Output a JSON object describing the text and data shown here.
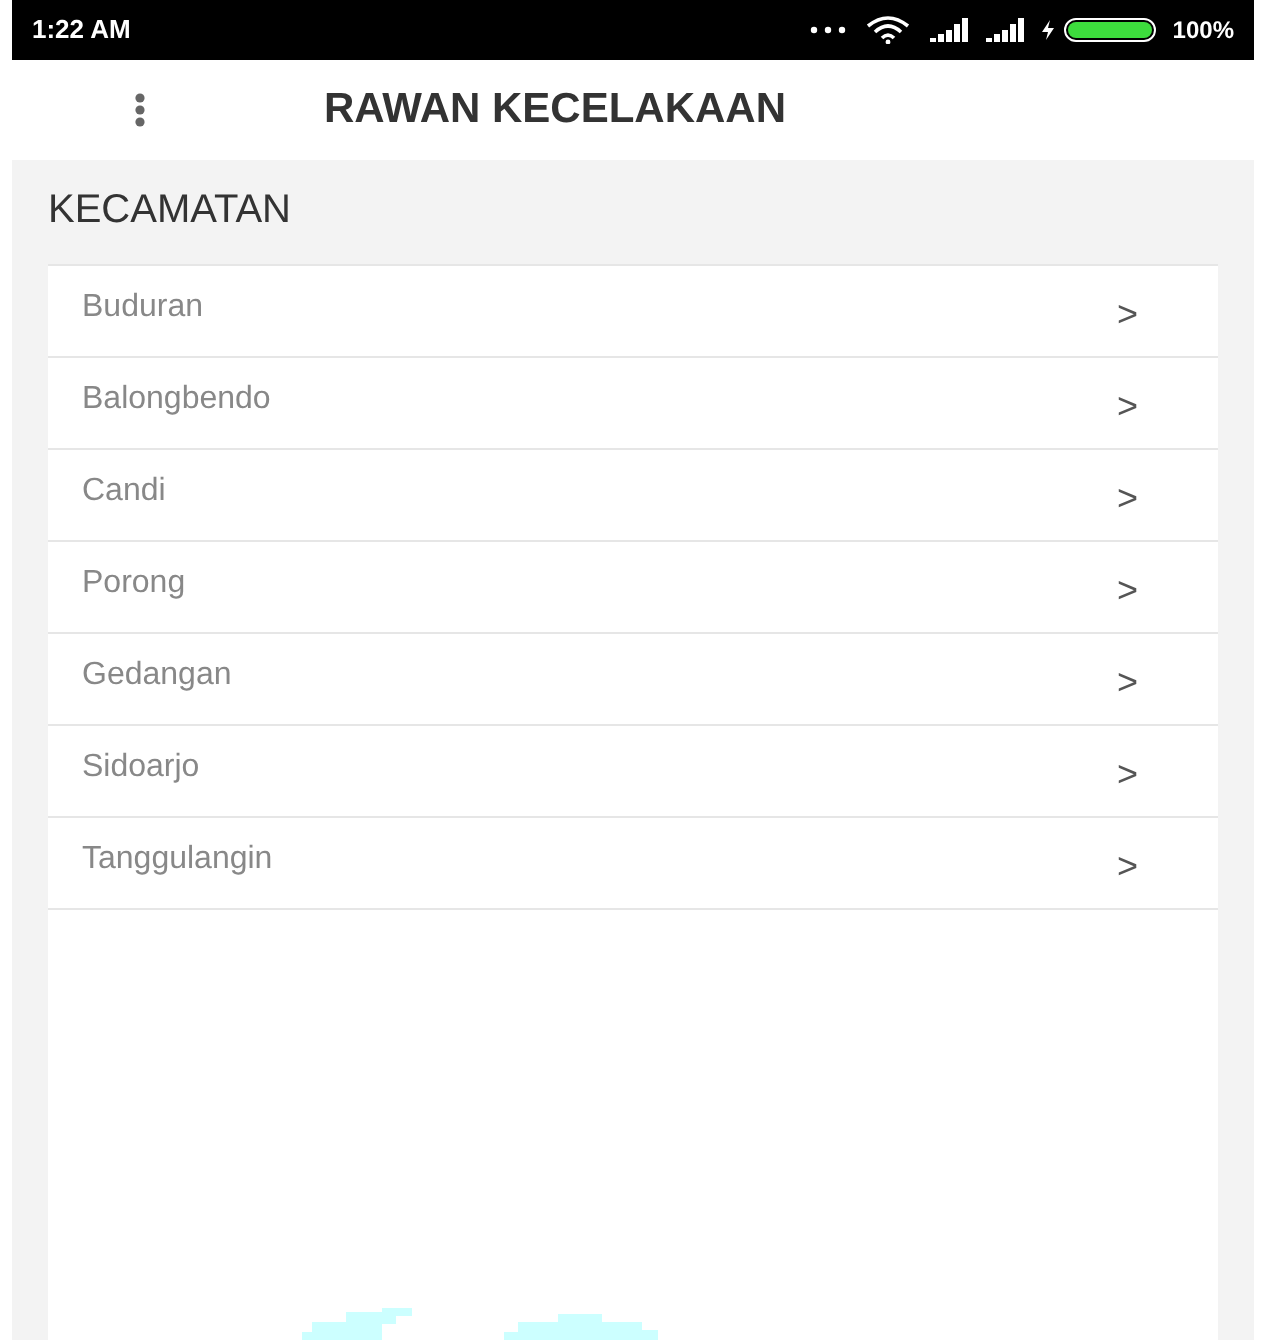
{
  "status_bar": {
    "time": "1:22 AM",
    "battery": "100%"
  },
  "app_bar": {
    "title": "RAWAN KECELAKAAN"
  },
  "section": {
    "title": "KECAMATAN"
  },
  "items": [
    {
      "label": "Buduran",
      "chevron": ">"
    },
    {
      "label": "Balongbendo",
      "chevron": ">"
    },
    {
      "label": "Candi",
      "chevron": ">"
    },
    {
      "label": "Porong",
      "chevron": ">"
    },
    {
      "label": "Gedangan",
      "chevron": ">"
    },
    {
      "label": "Sidoarjo",
      "chevron": ">"
    },
    {
      "label": "Tanggulangin",
      "chevron": ">"
    }
  ]
}
